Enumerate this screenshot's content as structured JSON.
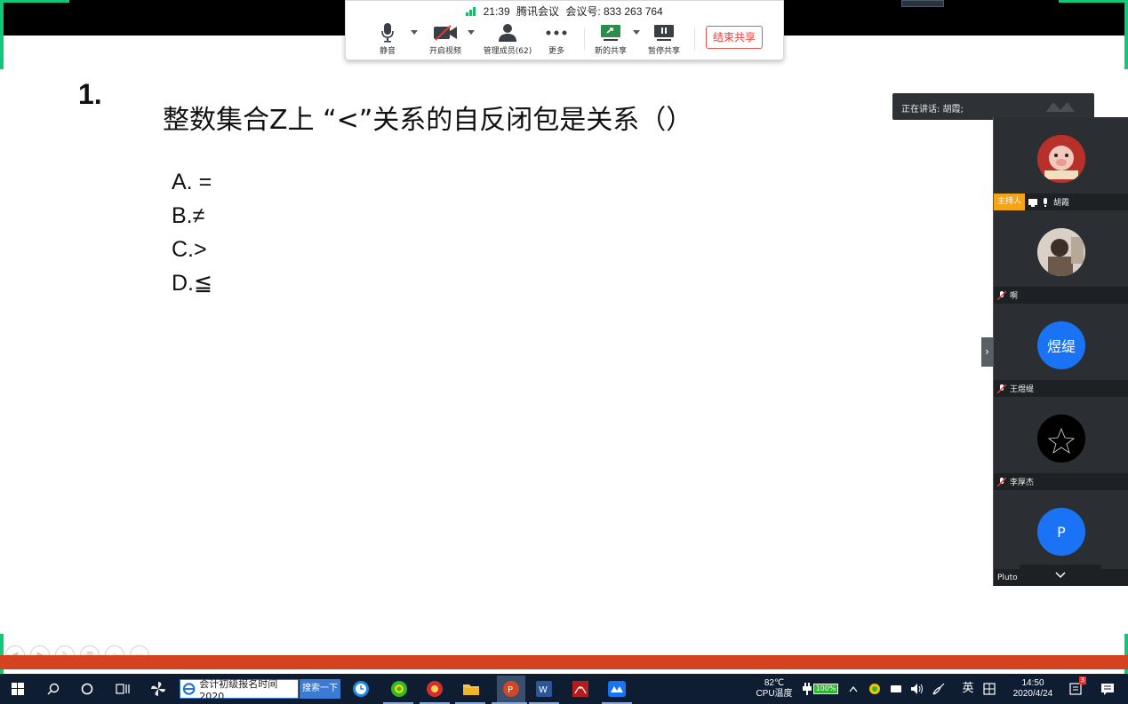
{
  "meeting": {
    "time": "21:39",
    "app_name": "腾讯会议",
    "meeting_id": "会议号: 833 263 764",
    "tools": {
      "mute": "静音",
      "video": "开启视频",
      "members": "管理成员(62)",
      "more": "更多",
      "new_share": "新的共享",
      "pause_share": "暂停共享"
    },
    "end_share": "结束共享"
  },
  "slide": {
    "number": "1.",
    "question": "整数集合Z上 “<”关系的自反闭包是关系（）",
    "options": [
      "A. =",
      "B.≠",
      "C.>",
      "D.≦"
    ]
  },
  "speaking": {
    "label": "正在讲话: 胡霞;"
  },
  "participants": [
    {
      "name": "胡霞",
      "host_label": "主持人",
      "avatar_text": "",
      "color": "#c0392b"
    },
    {
      "name": "啊",
      "avatar_text": "",
      "color": "#8a7b6a"
    },
    {
      "name": "王煜缇",
      "avatar_text": "煜缇",
      "color": "#1a73f5"
    },
    {
      "name": "李厚杰",
      "avatar_text": "",
      "color": "#000000"
    },
    {
      "name": "Pluto",
      "avatar_text": "P",
      "color": "#1a73f5"
    }
  ],
  "taskbar": {
    "search_text": "会计初级报名时间2020",
    "search_button": "搜索一下",
    "cpu_temp": "82℃",
    "cpu_label": "CPU温度",
    "battery": "100%",
    "ime": "英",
    "clock_time": "14:50",
    "clock_date": "2020/4/24",
    "notification_count": "3"
  },
  "colors": {
    "accent_green": "#10c978",
    "end_share_red": "#f03c3c",
    "progress_red": "#d44320",
    "host_orange": "#f5a316",
    "taskbar_bg": "#0f1d33"
  }
}
